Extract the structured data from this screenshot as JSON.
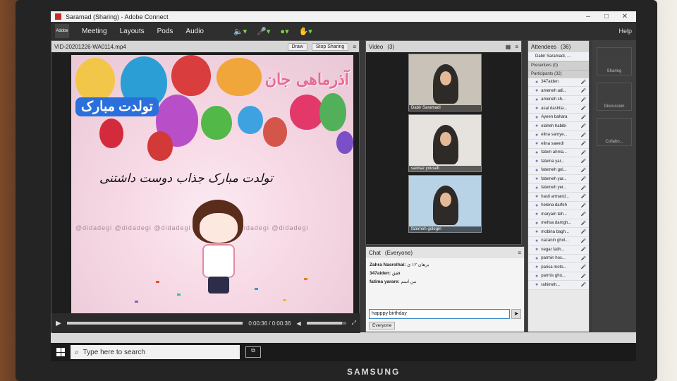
{
  "window": {
    "title": "Saramad (Sharing) - Adobe Connect",
    "help": "Help"
  },
  "menu": {
    "logo_text": "Adobe",
    "items": [
      "Meeting",
      "Layouts",
      "Pods",
      "Audio"
    ],
    "icons": [
      "speaker-icon",
      "microphone-icon",
      "webcam-icon",
      "raise-hand-icon"
    ]
  },
  "share_pod": {
    "title": "VID-20201226-WA0114.mp4",
    "btn_draw": "Draw",
    "btn_stop": "Stop Sharing",
    "time": "0:00:36 / 0:00:36",
    "progress": 1.0,
    "volume": 0.9,
    "content": {
      "headline": "آذرماهی جان",
      "subheadline": "تولدت مبارک",
      "line": "تولدت مبارک جذاب دوست داشتنی",
      "watermark": "@didadegi @didadegi @didadegi @didadegi @didadegi @didadegi"
    }
  },
  "video_pod": {
    "title": "Video",
    "count": "(3)",
    "tiles": [
      {
        "name": "Dabir Saramadi"
      },
      {
        "name": "saimaz yousefi"
      },
      {
        "name": "fatemeh golegiri"
      }
    ]
  },
  "chat_pod": {
    "title": "Chat",
    "scope": "(Everyone)",
    "messages": [
      {
        "sender": "Zahra Nasrolhai:",
        "text": "برهان ۱۲ ی"
      },
      {
        "sender": "347aiden:",
        "text": "ققق"
      },
      {
        "sender": "fatima yarare:",
        "text": "من اسم"
      }
    ],
    "input_value": "happpy birthday",
    "send_to": "Everyone"
  },
  "attendees_pod": {
    "title": "Attendees",
    "count": "(36)",
    "host": "Dabir Saramadi, ...",
    "presenters_label": "Presenters (0)",
    "participants_label": "Participants (32)",
    "participants": [
      "347aiden",
      "ameneh adi...",
      "ameneh sh...",
      "asal dashtia...",
      "Ayeen bahara",
      "elaheh habibi",
      "elina saroye...",
      "elina saeedi",
      "fatem ahma...",
      "fatema yar...",
      "fatemeh gol...",
      "fatemeh yar...",
      "fatemeh yer...",
      "hasti armand...",
      "helena darfeh",
      "maryam teh...",
      "mehsa damgh...",
      "mobina bagh...",
      "nazanin ghol...",
      "negar fatih...",
      "parmin hos...",
      "parisa moto...",
      "parmis gho...",
      "rahimeh..."
    ]
  },
  "rail": [
    "Sharing",
    "Discussion",
    "Collabo..."
  ],
  "taskbar": {
    "search_placeholder": "Type here to search"
  },
  "monitor": {
    "brand": "SAMSUNG"
  }
}
